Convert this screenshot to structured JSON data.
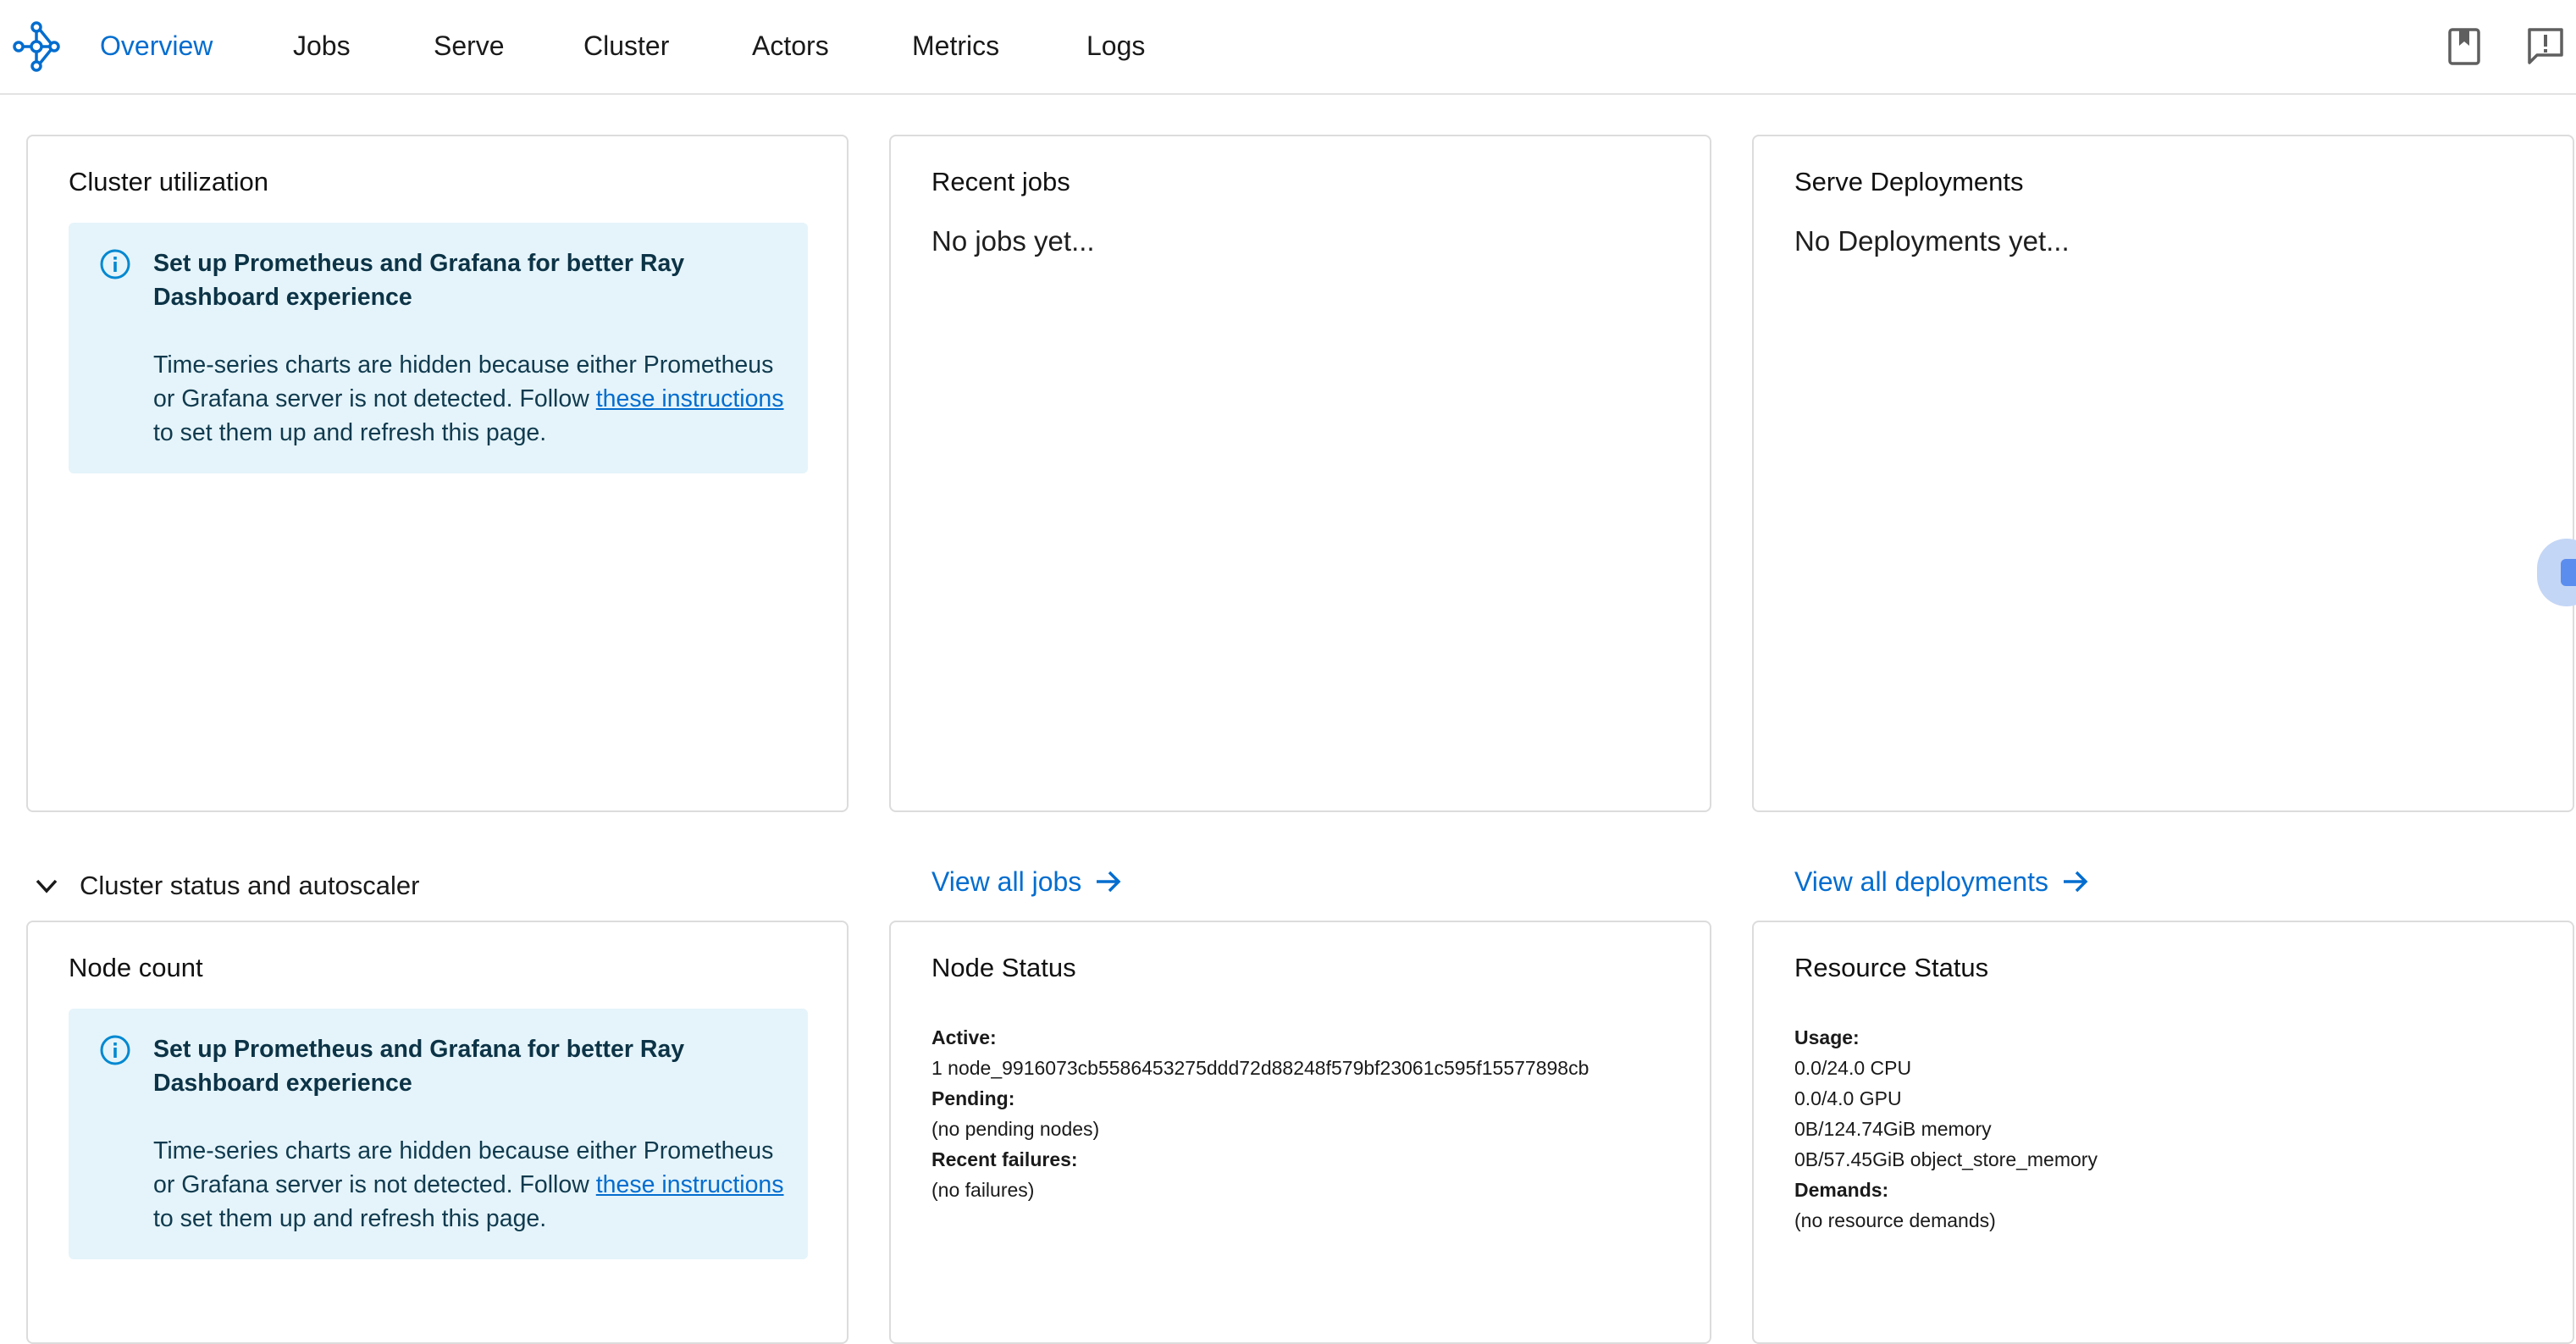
{
  "nav": {
    "items": [
      "Overview",
      "Jobs",
      "Serve",
      "Cluster",
      "Actors",
      "Metrics",
      "Logs"
    ],
    "active": "Overview",
    "right_icons": [
      "docs-book-icon",
      "feedback-icon"
    ]
  },
  "alert": {
    "title": "Set up Prometheus and Grafana for better Ray Dashboard experience",
    "body_before_link": "Time-series charts are hidden because either Prometheus or Grafana server is not detected. Follow ",
    "link_text": "these instructions",
    "body_after_link": " to set them up and refresh this page."
  },
  "cards": {
    "cluster_utilization": {
      "title": "Cluster utilization"
    },
    "recent_jobs": {
      "title": "Recent jobs",
      "empty": "No jobs yet...",
      "view_all": "View all jobs"
    },
    "serve_deployments": {
      "title": "Serve Deployments",
      "empty": "No Deployments yet...",
      "view_all": "View all deployments"
    }
  },
  "section": {
    "title": "Cluster status and autoscaler"
  },
  "status_cards": {
    "node_count": {
      "title": "Node count"
    },
    "node_status": {
      "title": "Node Status",
      "active_label": "Active:",
      "active_value": "1 node_9916073cb5586453275ddd72d88248f579bf23061c595f15577898cb",
      "pending_label": "Pending:",
      "pending_value": "(no pending nodes)",
      "failures_label": "Recent failures:",
      "failures_value": "(no failures)"
    },
    "resource_status": {
      "title": "Resource Status",
      "usage_label": "Usage:",
      "usage": [
        "0.0/24.0 CPU",
        "0.0/4.0 GPU",
        "0B/124.74GiB memory",
        "0B/57.45GiB object_store_memory"
      ],
      "demands_label": "Demands:",
      "demands_value": "(no resource demands)"
    }
  },
  "colors": {
    "accent": "#036dcf",
    "alert_bg": "#e5f4fa",
    "card_border": "#dcdcdc"
  }
}
